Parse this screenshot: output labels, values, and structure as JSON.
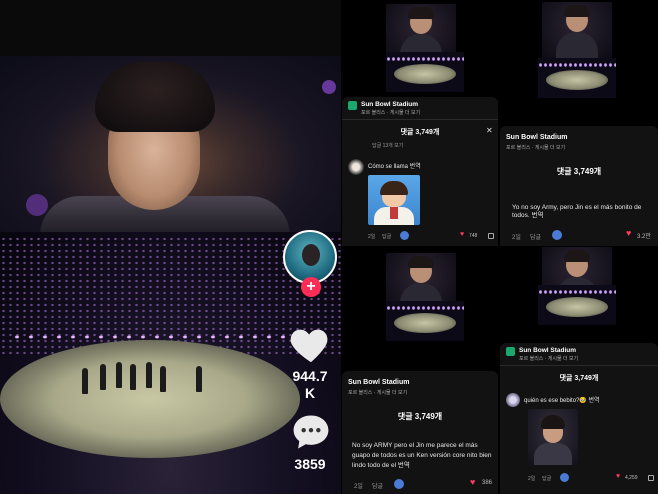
{
  "colors": {
    "accent_red": "#ff2c55",
    "heart_red": "#ff3b5c",
    "sheet_bg": "#121212",
    "venue_green": "#1aa86e"
  },
  "main_video": {
    "like_count_line1": "944.7",
    "like_count_line2": "K",
    "comment_count": "3859",
    "follow_plus": "+"
  },
  "sheet_tr_front": {
    "venue": "Sun Bowl Stadium",
    "subtitle": "포르 블리스 · 게시물 더 보기",
    "comment_count": "댓글 3,749개",
    "close": "✕",
    "comment_text": "Yo no soy Army, pero Jin es el más bonito de todos. 번역",
    "meta_time": "2일",
    "meta_reply": "답글",
    "likes": "3.2만"
  },
  "sheet_tr_back": {
    "venue": "Sun Bowl Stadium",
    "subtitle": "포르 블리스 · 게시물 더 보기",
    "comment_count": "댓글 3,749개",
    "close": "✕",
    "view_replies": "답글 13개 보기",
    "comment_text": "Cómo se llama 번역",
    "meta_time": "2일",
    "meta_reply": "답글",
    "likes": "748"
  },
  "sheet_br_back": {
    "venue": "Sun Bowl Stadium",
    "subtitle": "포르 블리스 · 게시물 더 보기",
    "comment_count": "댓글 3,749개",
    "comment_text": "No soy ARMY pero el Jin me parece el más guapo de todos es un Ken versión core nito bien lindo todo de el 번역",
    "meta_time": "2일",
    "meta_reply": "답글",
    "likes": "386"
  },
  "sheet_br_front": {
    "venue": "Sun Bowl Stadium",
    "subtitle": "포르 블리스 · 게시물 더 보기",
    "comment_count": "댓글 3,749개",
    "comment_text": "quién es ese bebito?🥹 번역",
    "meta_time": "2일",
    "meta_reply": "답글",
    "likes": "4,259"
  },
  "icons": {
    "like": "heart-icon",
    "comment": "comment-bubble-icon",
    "close": "close-icon",
    "filter": "filter-icon",
    "heart_small": "heart-icon",
    "dislike": "dislike-icon"
  }
}
